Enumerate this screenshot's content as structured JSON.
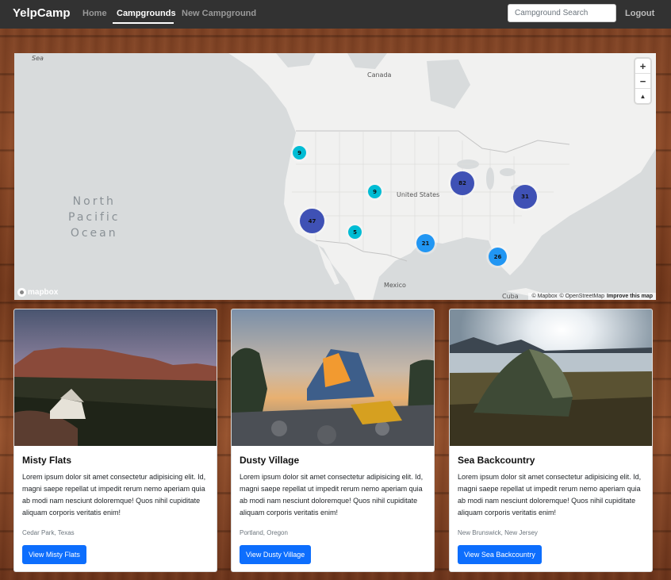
{
  "navbar": {
    "brand": "YelpCamp",
    "links": [
      "Home",
      "Campgrounds",
      "New Campground"
    ],
    "active_link": "Campgrounds",
    "search_placeholder": "Campground Search",
    "logout": "Logout"
  },
  "map": {
    "labels": {
      "canada": "Canada",
      "us": "United States",
      "mexico": "Mexico",
      "cuba": "Cuba",
      "sea": "Sea",
      "ocean_line1": "North",
      "ocean_line2": "Pacific",
      "ocean_line3": "Ocean"
    },
    "clusters": [
      {
        "count": "9",
        "color": "#00bcd4"
      },
      {
        "count": "9",
        "color": "#00bcd4"
      },
      {
        "count": "5",
        "color": "#00bcd4"
      },
      {
        "count": "47",
        "color": "#3f51b5"
      },
      {
        "count": "21",
        "color": "#2196f3"
      },
      {
        "count": "82",
        "color": "#3f51b5"
      },
      {
        "count": "31",
        "color": "#3f51b5"
      },
      {
        "count": "26",
        "color": "#2196f3"
      }
    ],
    "zoom_in": "+",
    "zoom_out": "−",
    "compass": "▲",
    "logo": "mapbox",
    "attribution": {
      "mapbox": "© Mapbox",
      "osm": "© OpenStreetMap",
      "improve": "Improve this map"
    }
  },
  "campgrounds": [
    {
      "title": "Misty Flats",
      "description": "Lorem ipsum dolor sit amet consectetur adipisicing elit. Id, magni saepe repellat ut impedit rerum nemo aperiam quia ab modi nam nesciunt doloremque! Quos nihil cupiditate aliquam corporis veritatis enim!",
      "location": "Cedar Park, Texas",
      "button": "View Misty Flats"
    },
    {
      "title": "Dusty Village",
      "description": "Lorem ipsum dolor sit amet consectetur adipisicing elit. Id, magni saepe repellat ut impedit rerum nemo aperiam quia ab modi nam nesciunt doloremque! Quos nihil cupiditate aliquam corporis veritatis enim!",
      "location": "Portland, Oregon",
      "button": "View Dusty Village"
    },
    {
      "title": "Sea Backcountry",
      "description": "Lorem ipsum dolor sit amet consectetur adipisicing elit. Id, magni saepe repellat ut impedit rerum nemo aperiam quia ab modi nam nesciunt doloremque! Quos nihil cupiditate aliquam corporis veritatis enim!",
      "location": "New Brunswick, New Jersey",
      "button": "View Sea Backcountry"
    }
  ],
  "colors": {
    "navbar_bg": "#323232",
    "button_primary": "#0d6efd",
    "cluster_small": "#00bcd4",
    "cluster_medium": "#2196f3",
    "cluster_large": "#3f51b5"
  }
}
